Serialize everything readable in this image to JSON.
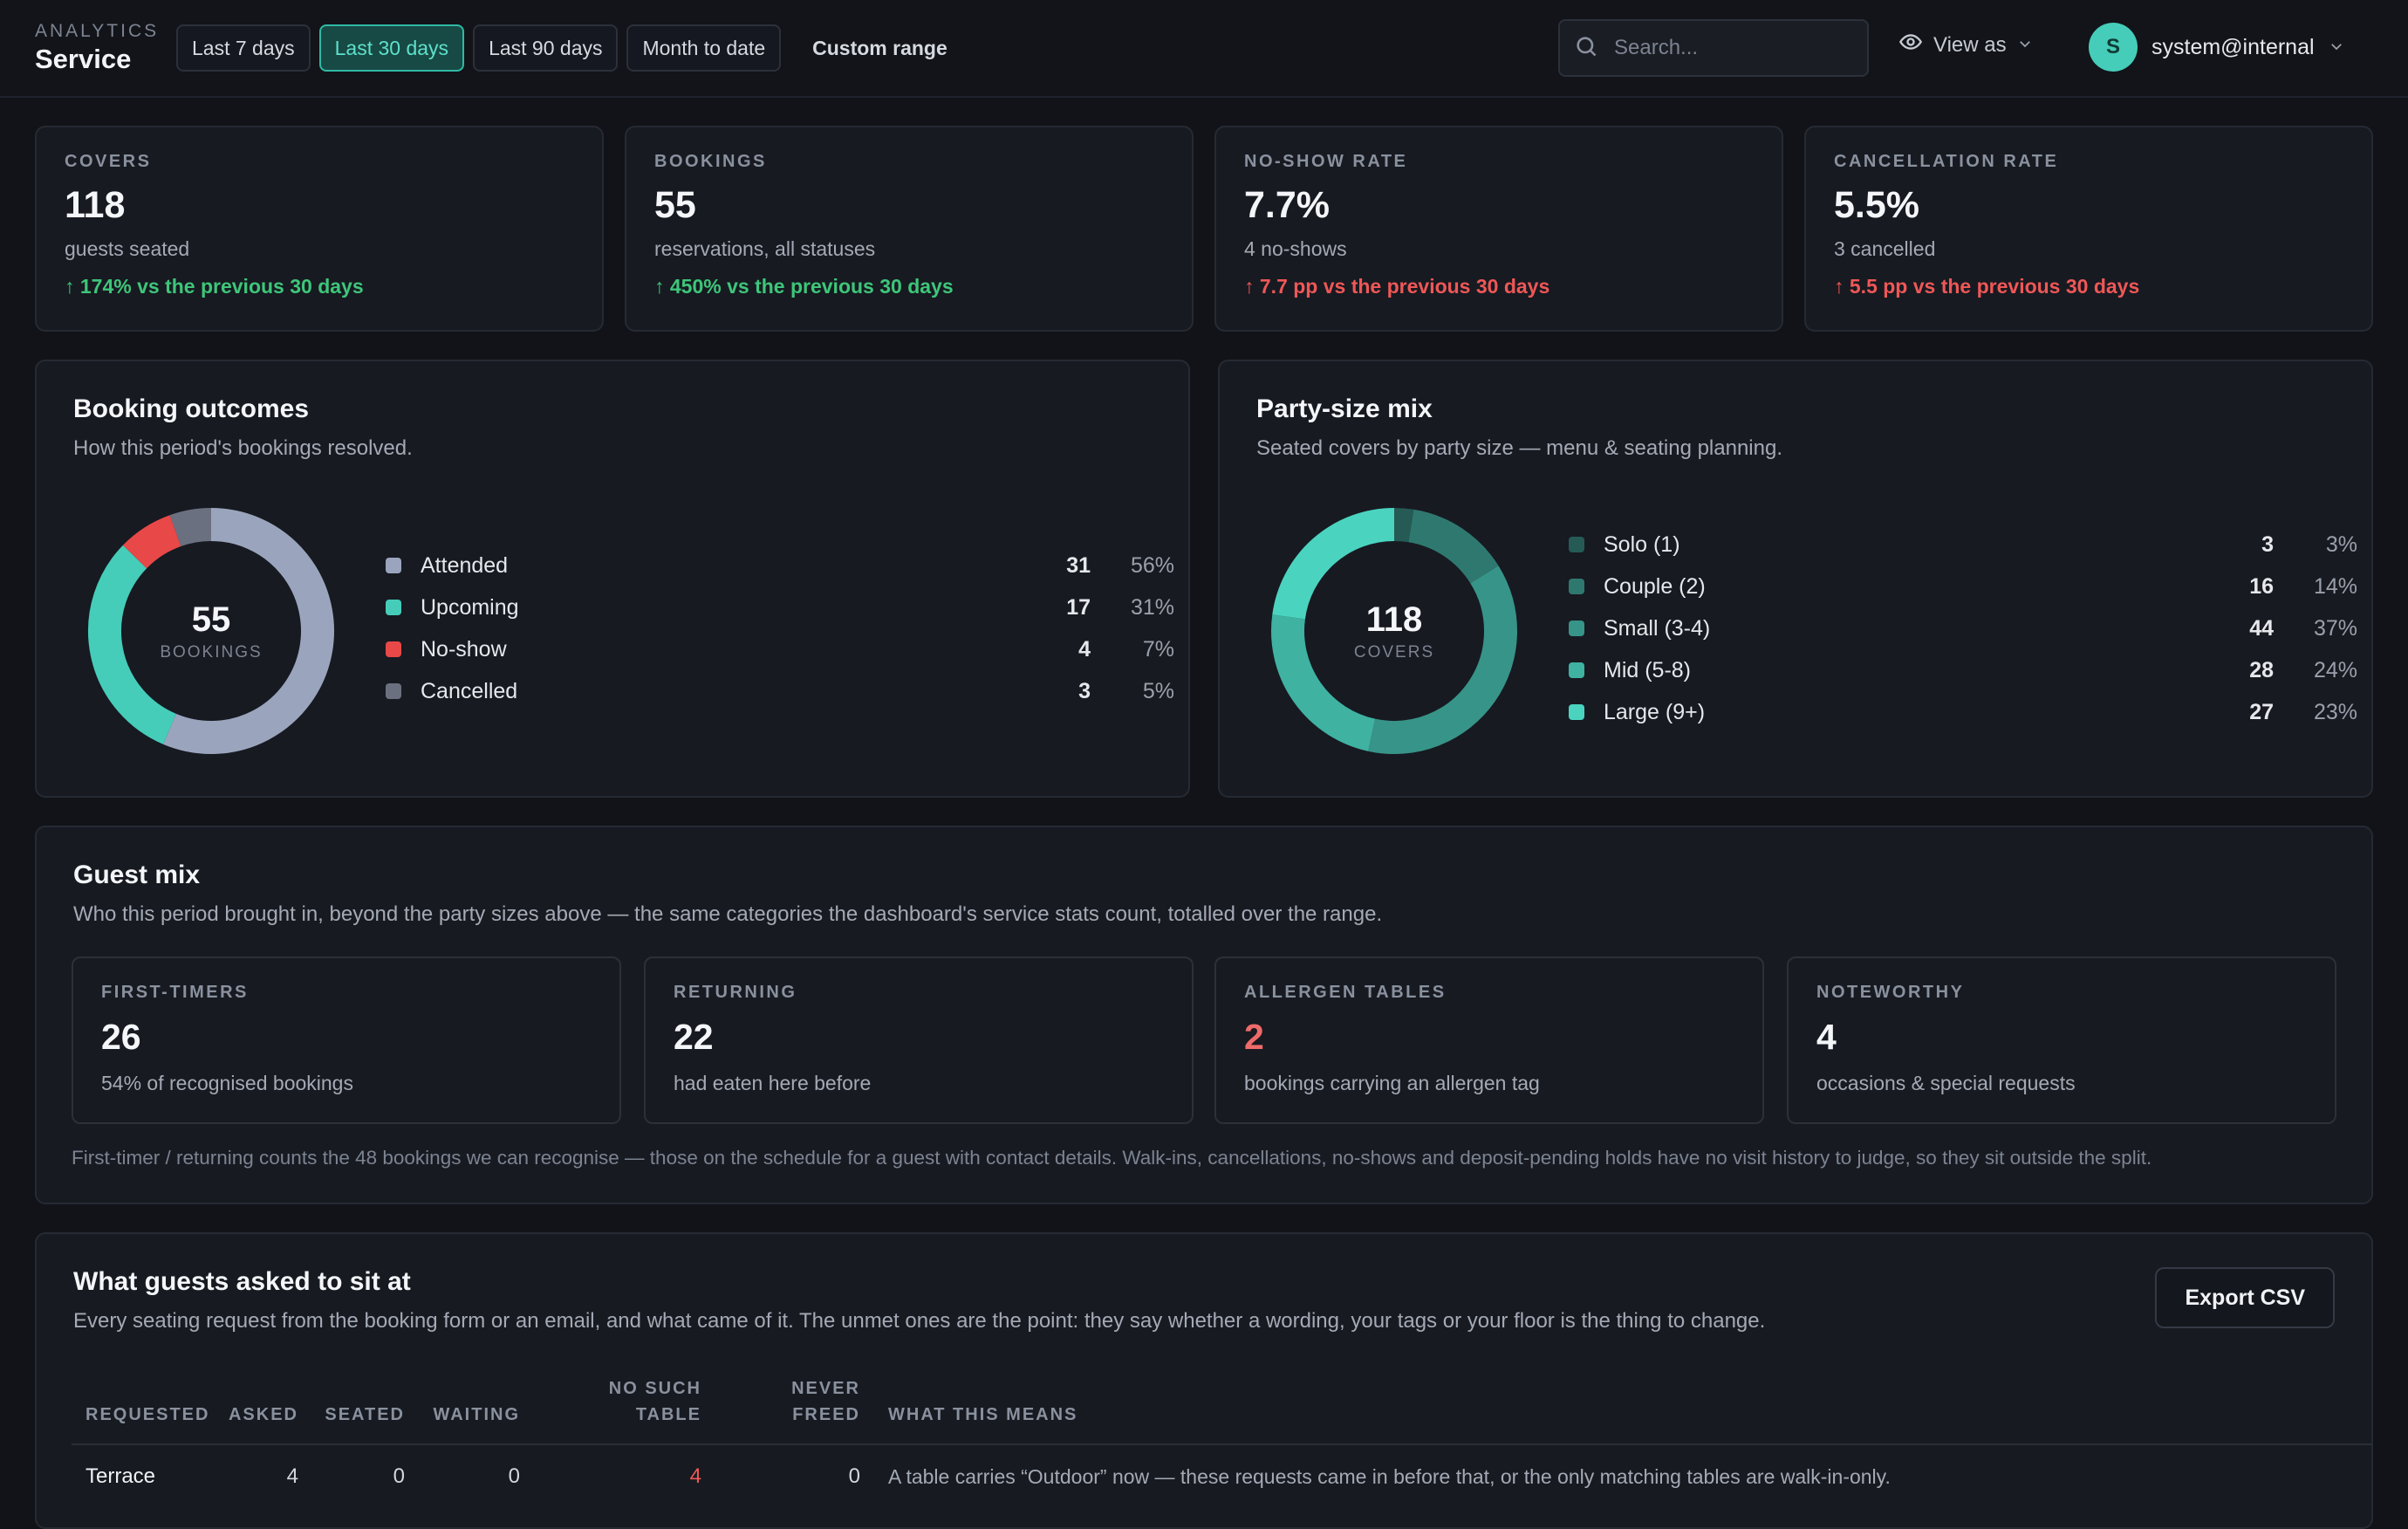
{
  "header": {
    "eyebrow": "ANALYTICS",
    "title": "Service",
    "ranges": [
      "Last 7 days",
      "Last 30 days",
      "Last 90 days",
      "Month to date"
    ],
    "active_range": "Last 30 days",
    "custom_range": "Custom range",
    "search_placeholder": "Search...",
    "view_as": "View as",
    "user_initial": "S",
    "user_email": "system@internal"
  },
  "kpis": [
    {
      "label": "COVERS",
      "value": "118",
      "sub": "guests seated",
      "delta": "↑ 174% vs the previous 30 days",
      "tone": "good"
    },
    {
      "label": "BOOKINGS",
      "value": "55",
      "sub": "reservations, all statuses",
      "delta": "↑ 450% vs the previous 30 days",
      "tone": "good"
    },
    {
      "label": "NO-SHOW RATE",
      "value": "7.7%",
      "sub": "4 no-shows",
      "delta": "↑ 7.7 pp vs the previous 30 days",
      "tone": "bad"
    },
    {
      "label": "CANCELLATION RATE",
      "value": "5.5%",
      "sub": "3 cancelled",
      "delta": "↑ 5.5 pp vs the previous 30 days",
      "tone": "bad"
    }
  ],
  "outcomes": {
    "title": "Booking outcomes",
    "subtitle": "How this period's bookings resolved.",
    "center_value": "55",
    "center_caption": "BOOKINGS",
    "items": [
      {
        "label": "Attended",
        "count": "31",
        "pct": "56%",
        "value": 31,
        "color": "#9aa5bd"
      },
      {
        "label": "Upcoming",
        "count": "17",
        "pct": "31%",
        "value": 17,
        "color": "#45cdb9"
      },
      {
        "label": "No-show",
        "count": "4",
        "pct": "7%",
        "value": 4,
        "color": "#e84848"
      },
      {
        "label": "Cancelled",
        "count": "3",
        "pct": "5%",
        "value": 3,
        "color": "#6b7080"
      }
    ]
  },
  "party": {
    "title": "Party-size mix",
    "subtitle": "Seated covers by party size — menu & seating planning.",
    "center_value": "118",
    "center_caption": "COVERS",
    "items": [
      {
        "label": "Solo (1)",
        "count": "3",
        "pct": "3%",
        "value": 3,
        "color": "#255a55"
      },
      {
        "label": "Couple (2)",
        "count": "16",
        "pct": "14%",
        "value": 16,
        "color": "#2f7870"
      },
      {
        "label": "Small (3-4)",
        "count": "44",
        "pct": "37%",
        "value": 44,
        "color": "#379488"
      },
      {
        "label": "Mid (5-8)",
        "count": "28",
        "pct": "24%",
        "value": 28,
        "color": "#3fb2a2"
      },
      {
        "label": "Large (9+)",
        "count": "27",
        "pct": "23%",
        "value": 27,
        "color": "#4ad4c0"
      }
    ]
  },
  "guest_mix": {
    "title": "Guest mix",
    "subtitle": "Who this period brought in, beyond the party sizes above — the same categories the dashboard's service stats count, totalled over the range.",
    "cards": [
      {
        "label": "FIRST-TIMERS",
        "value": "26",
        "sub": "54% of recognised bookings"
      },
      {
        "label": "RETURNING",
        "value": "22",
        "sub": "had eaten here before"
      },
      {
        "label": "ALLERGEN TABLES",
        "value": "2",
        "sub": "bookings carrying an allergen tag"
      },
      {
        "label": "NOTEWORTHY",
        "value": "4",
        "sub": "occasions & special requests"
      }
    ],
    "footnote": "First-timer / returning counts the 48 bookings we can recognise — those on the schedule for a guest with contact details. Walk-ins, cancellations, no-shows and deposit-pending holds have no visit history to judge, so they sit outside the split."
  },
  "seating": {
    "title": "What guests asked to sit at",
    "subtitle": "Every seating request from the booking form or an email, and what came of it. The unmet ones are the point: they say whether a wording, your tags or your floor is the thing to change.",
    "export_label": "Export CSV",
    "columns": [
      "REQUESTED",
      "ASKED",
      "SEATED",
      "WAITING",
      "NO SUCH TABLE",
      "NEVER FREED",
      "WHAT THIS MEANS"
    ],
    "rows": [
      {
        "requested": "Terrace",
        "asked": "4",
        "seated": "0",
        "waiting": "0",
        "no_such_table": "4",
        "never_freed": "0",
        "meaning": "A table carries “Outdoor” now — these requests came in before that, or the only matching tables are walk-in-only."
      }
    ]
  }
}
